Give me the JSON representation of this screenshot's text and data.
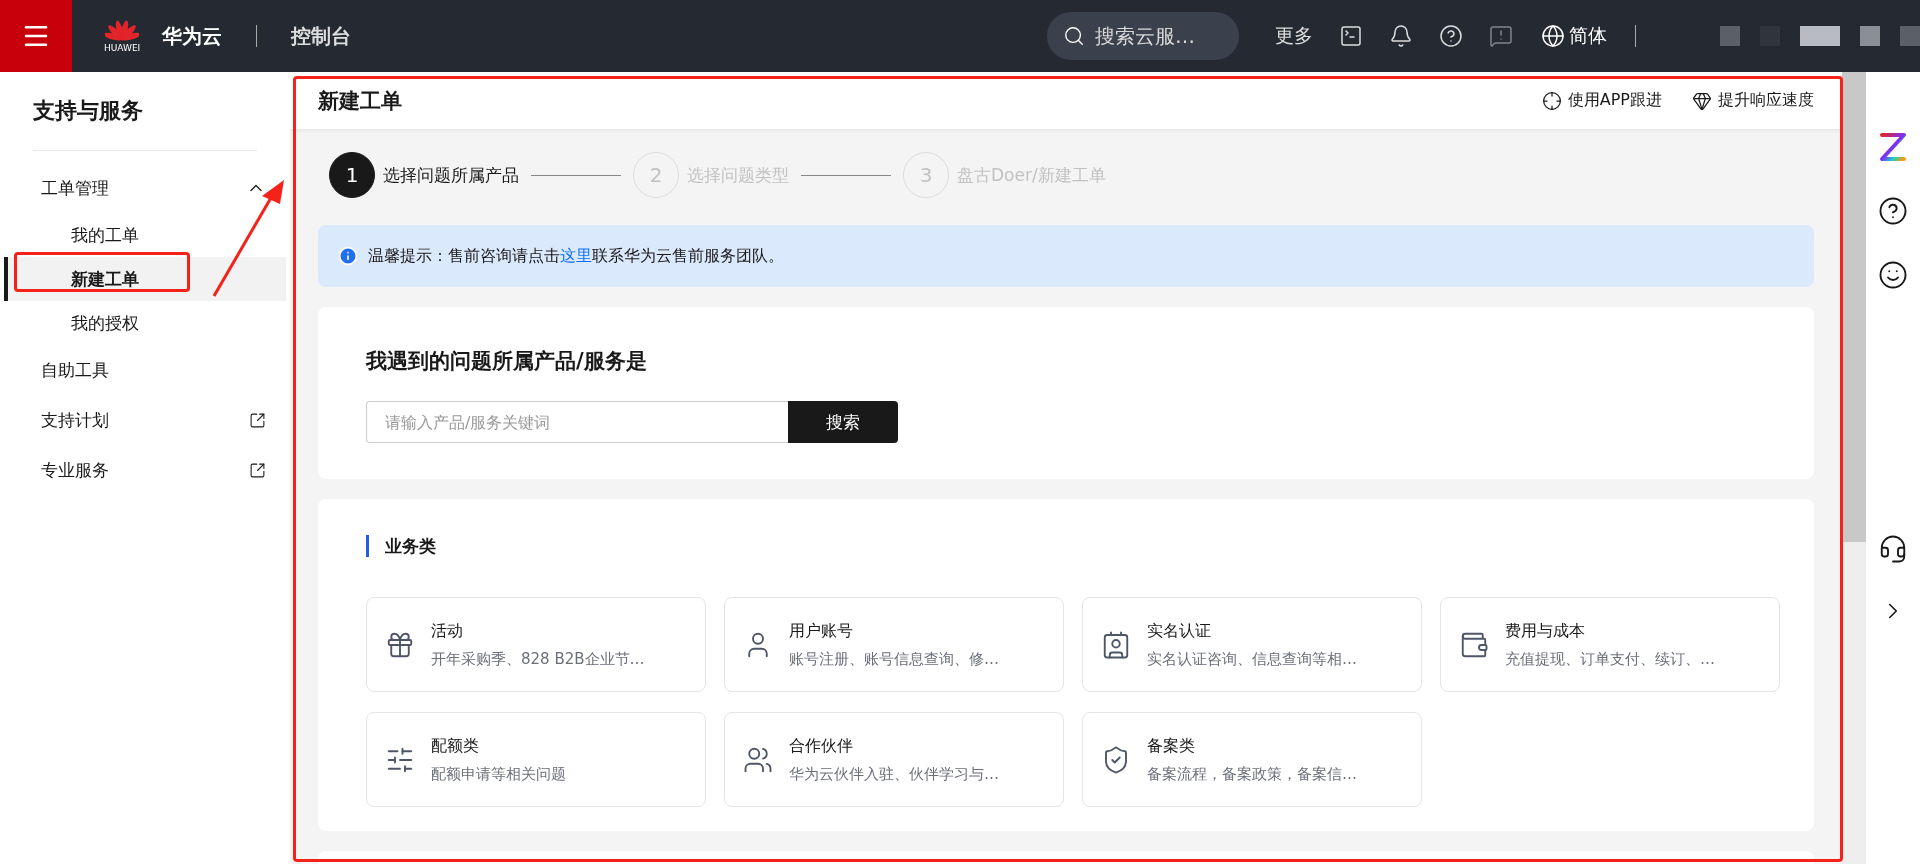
{
  "topbar": {
    "logo_text": "HUAWEI",
    "brand": "华为云",
    "console": "控制台",
    "search": {
      "placeholder": "搜索云服…"
    },
    "more": "更多",
    "language": "简体"
  },
  "sidebar": {
    "title": "支持与服务",
    "items": [
      {
        "label": "工单管理",
        "expanded": true,
        "external": false,
        "selected": false,
        "children": [
          {
            "label": "我的工单",
            "selected": false
          },
          {
            "label": "新建工单",
            "selected": true
          },
          {
            "label": "我的授权",
            "selected": false
          }
        ]
      },
      {
        "label": "自助工具",
        "expanded": false,
        "external": false,
        "selected": false
      },
      {
        "label": "支持计划",
        "expanded": false,
        "external": true,
        "selected": false
      },
      {
        "label": "专业服务",
        "expanded": false,
        "external": true,
        "selected": false
      }
    ]
  },
  "page": {
    "title": "新建工单",
    "actions": [
      "使用APP跟进",
      "提升响应速度"
    ],
    "steps": [
      {
        "number": "1",
        "label": "选择问题所属产品",
        "selected": true
      },
      {
        "number": "2",
        "label": "选择问题类型",
        "selected": false
      },
      {
        "number": "3",
        "label": "盘古Doer/新建工单",
        "selected": false
      }
    ],
    "notice": {
      "prefix": "温馨提示：售前咨询请点击",
      "link": "这里",
      "suffix": "联系华为云售前服务团队。"
    },
    "search_card": {
      "heading": "我遇到的问题所属产品/服务是",
      "placeholder": "请输入产品/服务关键词",
      "button": "搜索"
    },
    "category": {
      "heading": "业务类",
      "items": [
        {
          "title": "活动",
          "description": "开年采购季、828 B2B企业节…"
        },
        {
          "title": "用户账号",
          "description": "账号注册、账号信息查询、修…"
        },
        {
          "title": "实名认证",
          "description": "实名认证咨询、信息查询等相…"
        },
        {
          "title": "费用与成本",
          "description": "充值提现、订单支付、续订、…"
        },
        {
          "title": "配额类",
          "description": "配额申请等相关问题"
        },
        {
          "title": "合作伙伴",
          "description": "华为云伙伴入驻、伙伴学习与…"
        },
        {
          "title": "备案类",
          "description": "备案流程，备案政策，备案信…"
        }
      ]
    }
  }
}
